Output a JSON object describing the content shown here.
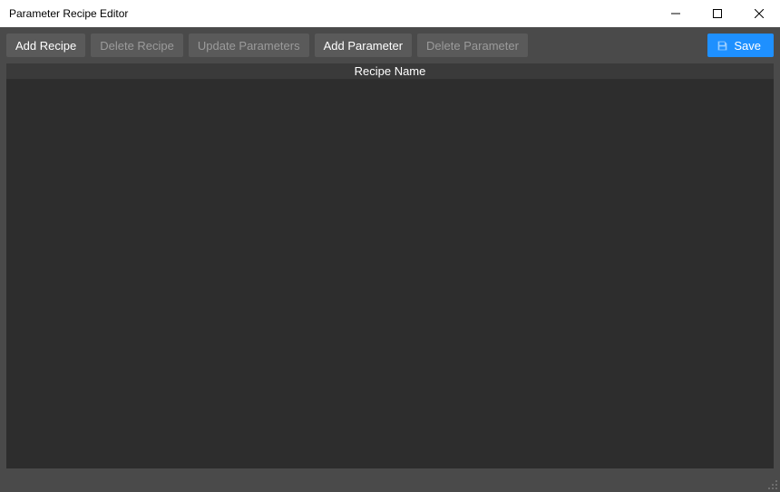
{
  "window": {
    "title": "Parameter Recipe Editor"
  },
  "toolbar": {
    "add_recipe": "Add Recipe",
    "delete_recipe": "Delete Recipe",
    "update_parameters": "Update Parameters",
    "add_parameter": "Add Parameter",
    "delete_parameter": "Delete Parameter",
    "save": "Save"
  },
  "table": {
    "header": "Recipe Name",
    "rows": []
  }
}
